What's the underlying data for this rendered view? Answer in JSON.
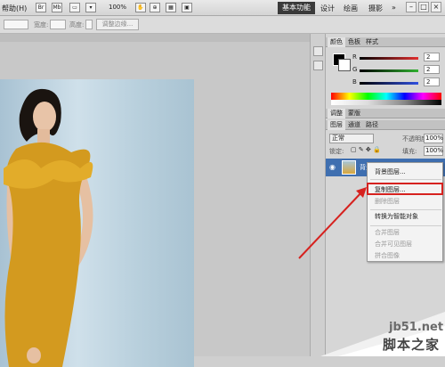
{
  "appbar": {
    "menu_help": "帮助(H)",
    "tool_icons": [
      "Br",
      "Mb"
    ],
    "zoom": "100%",
    "workspace_active": "基本功能",
    "workspaces": [
      "设计",
      "绘画",
      "摄影"
    ],
    "expand": "»",
    "window_controls": [
      "–",
      "□",
      "×"
    ]
  },
  "optbar": {
    "width_label": "宽度:",
    "height_label": "高度:",
    "refine_edge": "调整边缘..."
  },
  "panel": {
    "color_tabs": [
      "颜色",
      "色板",
      "样式"
    ],
    "channels": [
      {
        "label": "R",
        "value": "2",
        "color": "#e23030"
      },
      {
        "label": "G",
        "value": "2",
        "color": "#2fb02f"
      },
      {
        "label": "B",
        "value": "2",
        "color": "#3050e0"
      }
    ],
    "adjust_tabs": [
      "调整",
      "蒙版"
    ],
    "layer_tabs": [
      "图层",
      "通道",
      "路径"
    ],
    "blend_mode": "正常",
    "opacity_label": "不透明度:",
    "opacity": "100%",
    "lock_label": "锁定:",
    "fill_label": "填充:",
    "fill": "100%",
    "layer_name": "背景"
  },
  "context_menu": {
    "items": [
      {
        "label": "背景图层...",
        "enabled": true
      },
      {
        "label": "复制图层...",
        "enabled": true
      },
      {
        "label": "删除图层",
        "enabled": false
      },
      {
        "label": "转换为智能对象",
        "enabled": true
      },
      {
        "label": "合并图层",
        "enabled": false
      },
      {
        "label": "合并可见图层",
        "enabled": false
      },
      {
        "label": "拼合图像",
        "enabled": false
      }
    ]
  },
  "watermark": {
    "url": "jb51.net",
    "name": "脚本之家"
  }
}
